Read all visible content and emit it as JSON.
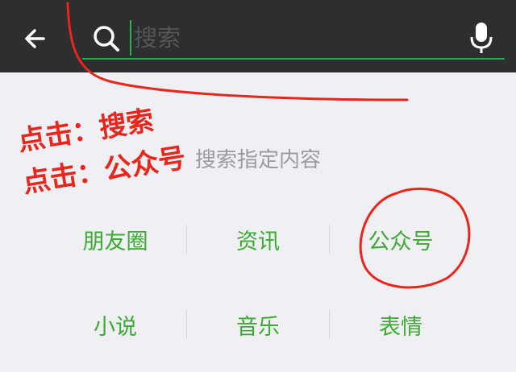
{
  "header": {
    "back_icon": "arrow-left-icon",
    "search_icon": "search-icon",
    "search_placeholder": "搜索",
    "mic_icon": "microphone-icon"
  },
  "hint": "搜索指定内容",
  "categories": {
    "items": [
      "朋友圈",
      "资讯",
      "公众号",
      "小说",
      "音乐",
      "表情"
    ]
  },
  "annotations": {
    "line1": "点击：搜索",
    "line2": "点击：公众号",
    "color": "#e8261c"
  },
  "colors": {
    "topbar": "#2c2e2f",
    "accent_green": "#3cab32",
    "background": "#efeff4"
  }
}
